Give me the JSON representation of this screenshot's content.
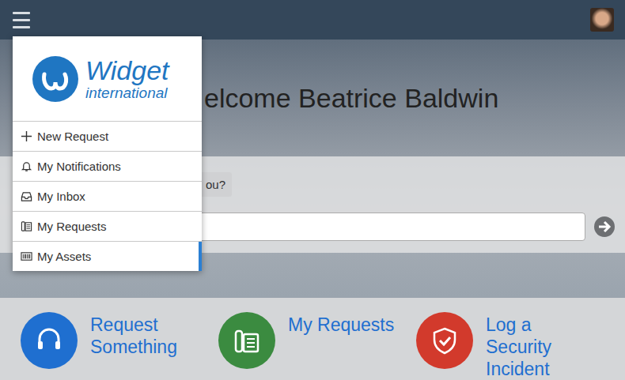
{
  "heading": "elcome Beatrice Baldwin",
  "question": "ou?",
  "menu": {
    "logo": {
      "title": "Widget",
      "subtitle": "international"
    },
    "items": [
      {
        "label": "New Request",
        "hovered": false
      },
      {
        "label": "My Notifications",
        "hovered": false
      },
      {
        "label": "My Inbox",
        "hovered": false
      },
      {
        "label": "My Requests",
        "hovered": false
      },
      {
        "label": "My Assets",
        "hovered": true
      }
    ]
  },
  "tiles": [
    {
      "label": "Request Something",
      "color": "#1f6fd0"
    },
    {
      "label": "My Requests",
      "color": "#3b8b40"
    },
    {
      "label": "Log a Security Incident",
      "color": "#d23a2c"
    }
  ]
}
